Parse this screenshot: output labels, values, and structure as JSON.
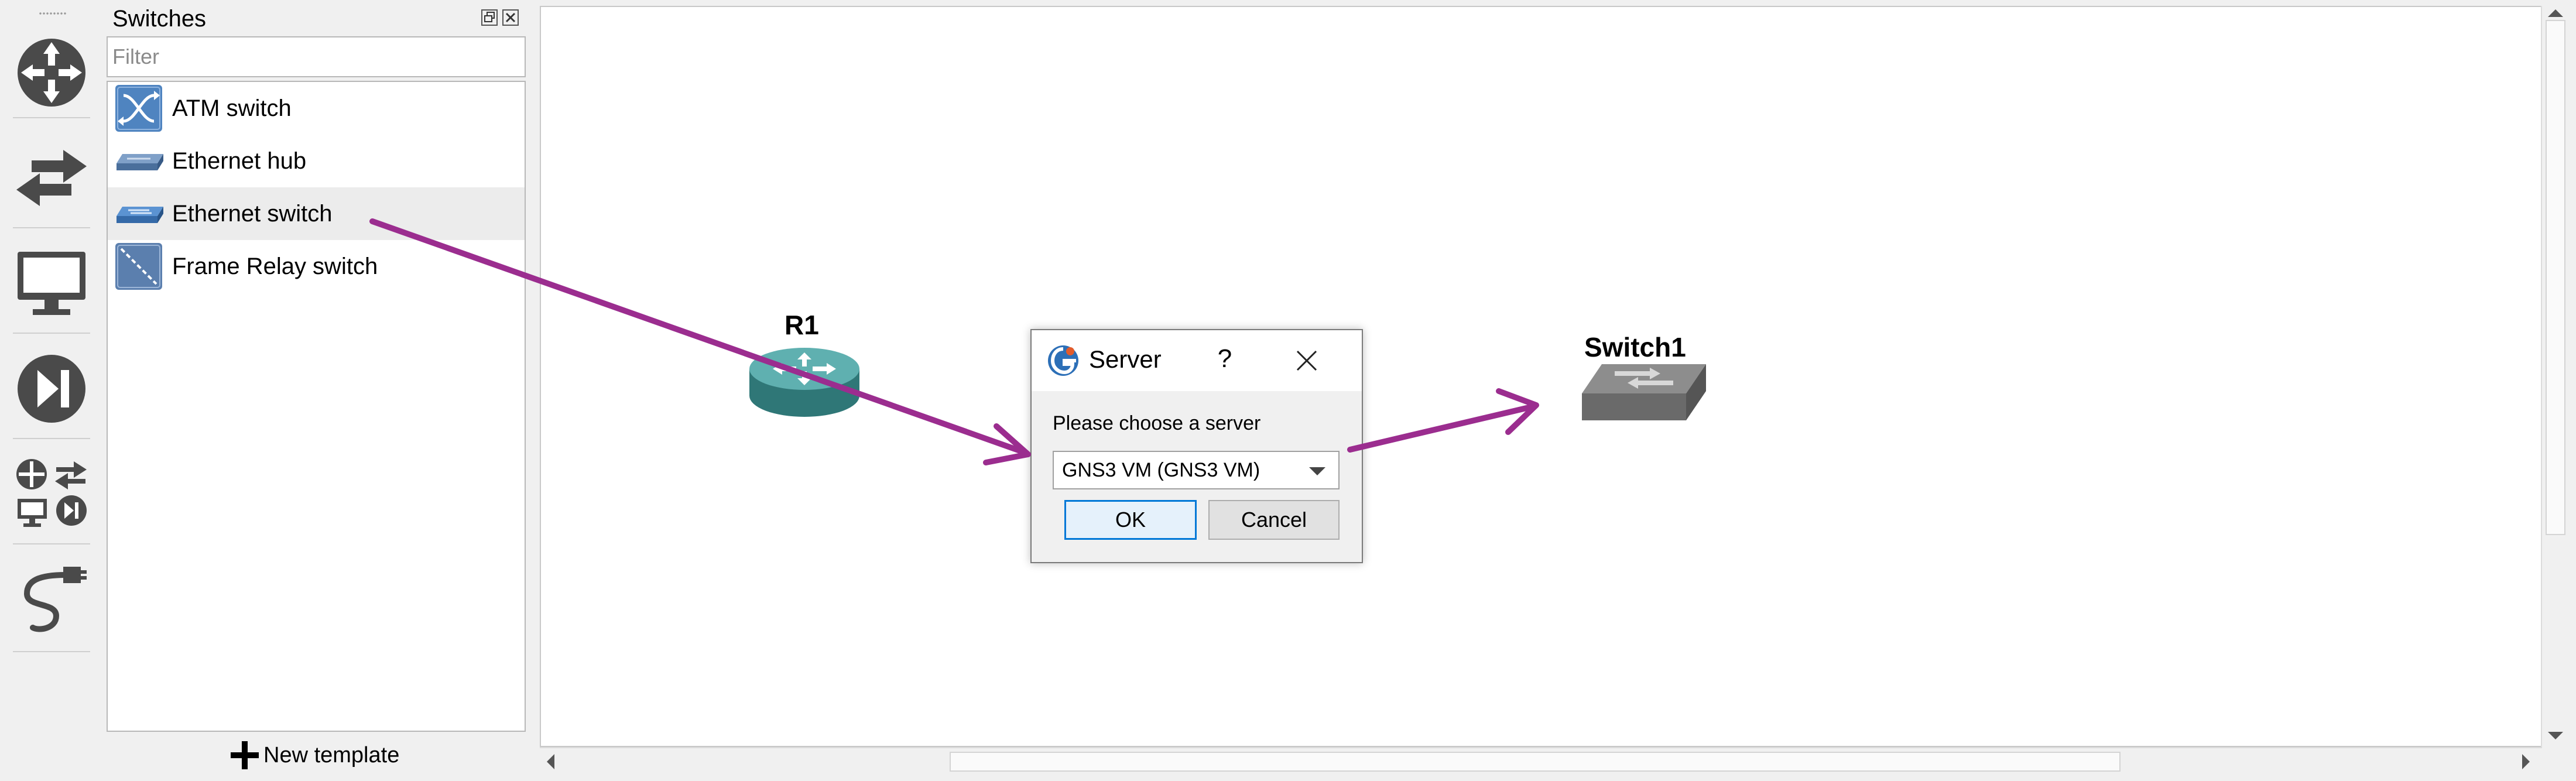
{
  "toolbar": {
    "buttons": [
      "routers",
      "switches",
      "end devices",
      "security devices",
      "all devices",
      "add a link"
    ]
  },
  "dock": {
    "title": "Switches",
    "filter_placeholder": "Filter",
    "items": [
      {
        "label": "ATM switch",
        "icon": "atm-switch-icon"
      },
      {
        "label": "Ethernet hub",
        "icon": "ethernet-hub-icon"
      },
      {
        "label": "Ethernet switch",
        "icon": "ethernet-switch-icon",
        "highlighted": true
      },
      {
        "label": "Frame Relay switch",
        "icon": "frame-relay-switch-icon"
      }
    ],
    "new_template_label": "New template"
  },
  "canvas": {
    "nodes": [
      {
        "label": "R1",
        "type": "router"
      },
      {
        "label": "Switch1",
        "type": "ethernet-switch"
      }
    ]
  },
  "dialog": {
    "title": "Server",
    "help": "?",
    "prompt": "Please choose a server",
    "selected_server": "GNS3 VM (GNS3 VM)",
    "ok_label": "OK",
    "cancel_label": "Cancel"
  },
  "colors": {
    "annotation_arrow": "#9b2d8f",
    "toolbar_icon": "#4a4a4a",
    "router_teal": "#3f8f8f",
    "switch_blue": "#4f84c0",
    "focus_border": "#0078d7"
  }
}
